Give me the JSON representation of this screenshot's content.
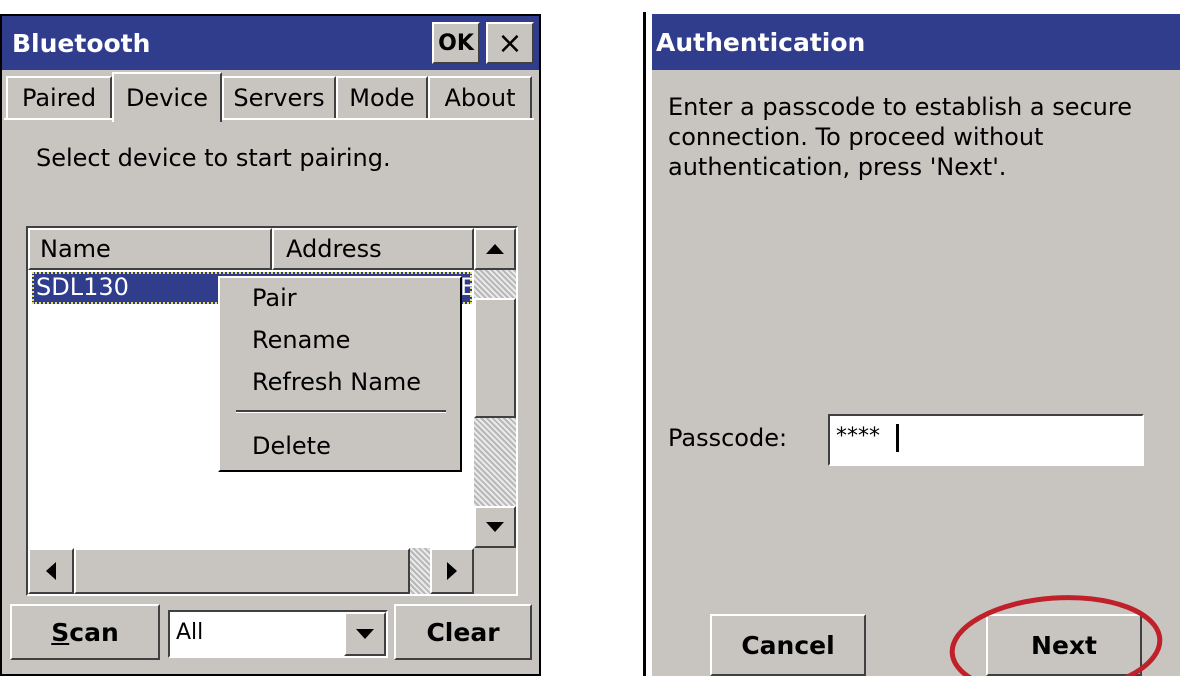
{
  "bluetooth": {
    "title": "Bluetooth",
    "ok_label": "OK",
    "close_label": "×",
    "tabs": [
      {
        "label": "Paired"
      },
      {
        "label": "Device",
        "active": true
      },
      {
        "label": "Servers"
      },
      {
        "label": "Mode"
      },
      {
        "label": "About"
      }
    ],
    "instruction": "Select device to start pairing.",
    "columns": [
      "Name",
      "Address"
    ],
    "rows": [
      {
        "name": "SDL130",
        "address_fragment": "E",
        "selected": true
      }
    ],
    "context_menu": {
      "items": [
        "Pair",
        "Rename",
        "Refresh Name"
      ],
      "after_separator": [
        "Delete"
      ]
    },
    "scan_label": "Scan",
    "scan_underline_char": "S",
    "filter_value": "All",
    "clear_label": "Clear"
  },
  "authentication": {
    "title": "Authentication",
    "message": "Enter a passcode to establish a secure connection. To proceed without authentication, press 'Next'.",
    "passcode_label": "Passcode:",
    "passcode_value": "****",
    "cancel_label": "Cancel",
    "next_label": "Next",
    "highlight_color": "#c0202a"
  },
  "colors": {
    "titlebar": "#303c8c",
    "face": "#c8c5c0",
    "selection": "#303c8c"
  }
}
